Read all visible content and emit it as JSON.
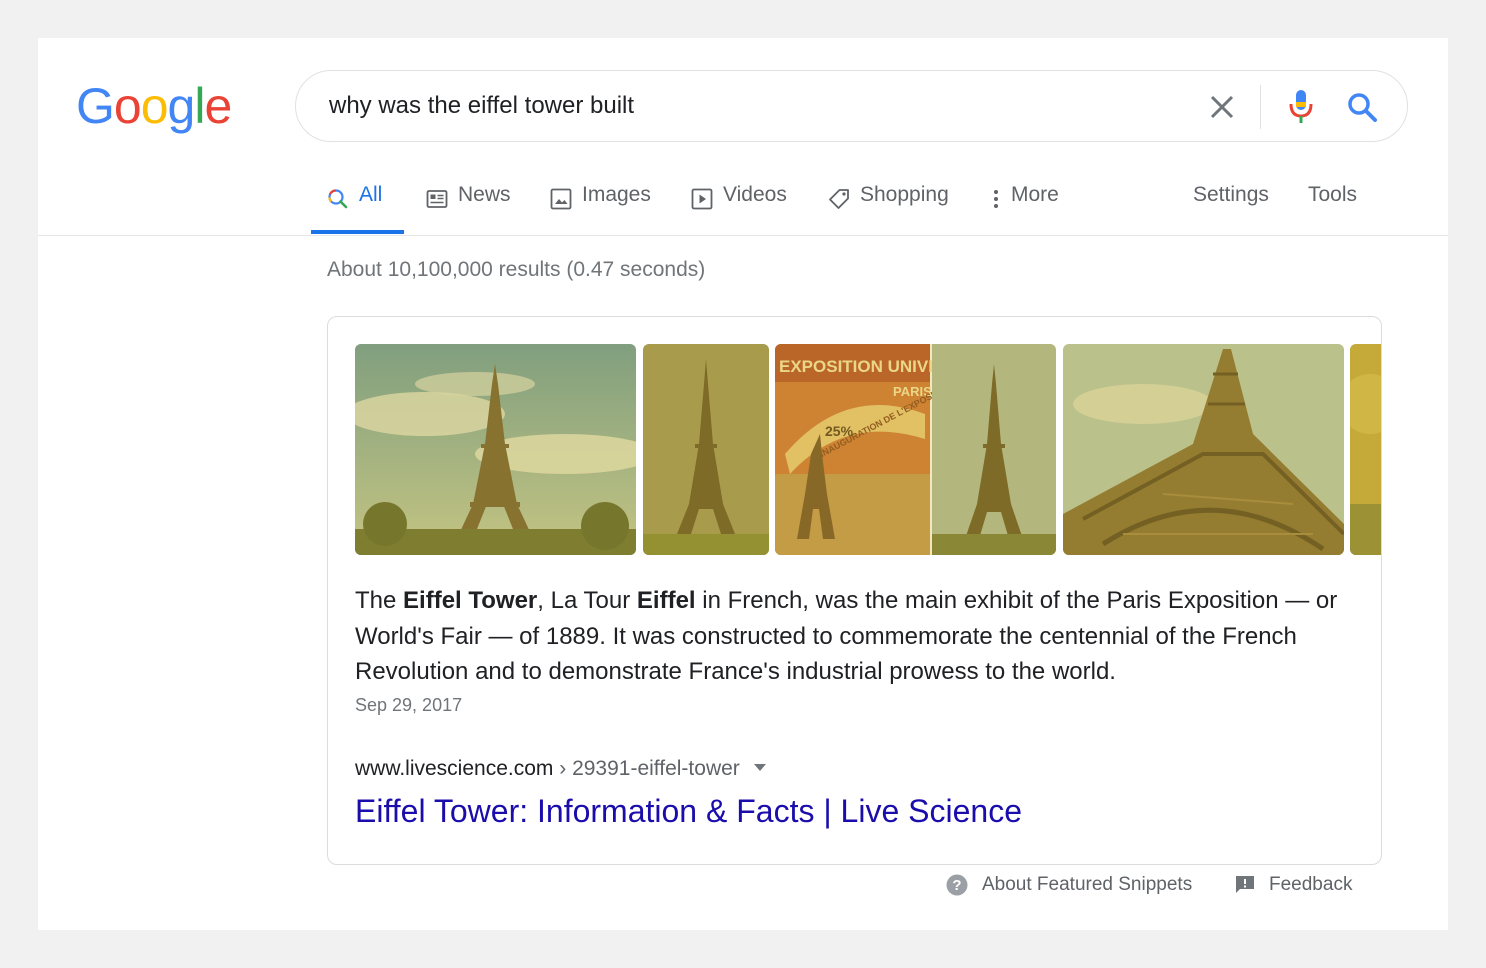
{
  "logo": {
    "text": "Google"
  },
  "search": {
    "query": "why was the eiffel tower built"
  },
  "tabs": [
    {
      "label": "All",
      "icon": "search-icon",
      "active": true
    },
    {
      "label": "News",
      "icon": "news-icon"
    },
    {
      "label": "Images",
      "icon": "image-icon"
    },
    {
      "label": "Videos",
      "icon": "video-icon"
    },
    {
      "label": "Shopping",
      "icon": "tag-icon"
    },
    {
      "label": "More",
      "icon": "more-vert-icon"
    }
  ],
  "tools": {
    "settings": "Settings",
    "tools": "Tools"
  },
  "result_stats": "About 10,100,000 results (0.47 seconds)",
  "featured_snippet": {
    "images": [
      "eiffel-tower-sky",
      "eiffel-tower-park",
      "exposition-poster",
      "eiffel-tower-lawn",
      "eiffel-tower-below",
      "eiffel-tower-autumn"
    ],
    "poster_text": {
      "line1": "EXPOSITION UNIVERSELLE",
      "line2": "PARIS",
      "line3": "INAUGURATION DE L'EXPOSITION",
      "line4": "25%"
    },
    "text": {
      "p1": "The ",
      "b1": "Eiffel Tower",
      "p2": ", La Tour ",
      "b2": "Eiffel",
      "p3": " in French, was the main exhibit of the Paris Exposition — or World's Fair — of 1889. It was constructed to commemorate the centennial of the French Revolution and to demonstrate France's industrial prowess to the world."
    },
    "date": "Sep 29, 2017",
    "cite_domain": "www.livescience.com",
    "cite_path": " › 29391-eiffel-tower",
    "link_title": "Eiffel Tower: Information & Facts | Live Science"
  },
  "footer": {
    "about": "About Featured Snippets",
    "feedback": "Feedback"
  },
  "colors": {
    "blue": "#4285f4",
    "red": "#ea4335",
    "yellow": "#fbbc05",
    "green": "#34a853",
    "link": "#1a0dab",
    "accent": "#1a73e8"
  }
}
